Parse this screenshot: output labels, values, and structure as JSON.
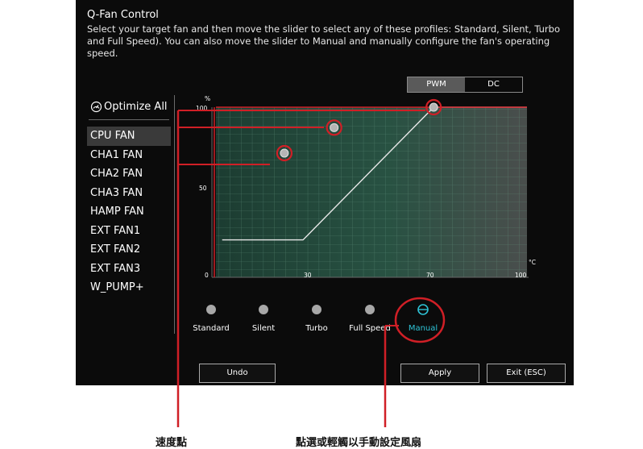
{
  "header": {
    "title": "Q-Fan Control",
    "description": "Select your target fan and then move the slider to select any of these profiles: Standard, Silent, Turbo and Full Speed). You can also move the slider to Manual and manually configure the fan's operating speed."
  },
  "mode_toggle": {
    "options": [
      "PWM",
      "DC"
    ],
    "selected": "PWM"
  },
  "fan_list": {
    "optimize_label": "Optimize All",
    "items": [
      "CPU FAN",
      "CHA1 FAN",
      "CHA2 FAN",
      "CHA3 FAN",
      "HAMP FAN",
      "EXT FAN1",
      "EXT FAN2",
      "EXT FAN3",
      "W_PUMP+"
    ],
    "selected": "CPU FAN"
  },
  "graph": {
    "y_unit": "%",
    "x_unit": "°C",
    "y_ticks": [
      "100",
      "50",
      "0"
    ],
    "x_ticks": [
      "30",
      "70",
      "100"
    ],
    "curve_points": [
      [
        2,
        22
      ],
      [
        28,
        22
      ],
      [
        70,
        100
      ],
      [
        100,
        100
      ]
    ],
    "speed_points": [
      [
        22,
        73
      ],
      [
        38,
        88
      ],
      [
        70,
        100
      ]
    ],
    "fill_color": "#2d5e4c",
    "curve_color": "#e8e8e8",
    "highlight_color": "#d01f26"
  },
  "profiles": {
    "items": [
      "Standard",
      "Silent",
      "Turbo",
      "Full Speed",
      "Manual"
    ],
    "selected": "Manual",
    "active_color": "#2ec3d6"
  },
  "buttons": {
    "undo": "Undo",
    "apply": "Apply",
    "exit": "Exit (ESC)"
  },
  "callouts": {
    "speed_point": "速度點",
    "manual_hint": "點選或輕觸以手動設定風扇"
  }
}
